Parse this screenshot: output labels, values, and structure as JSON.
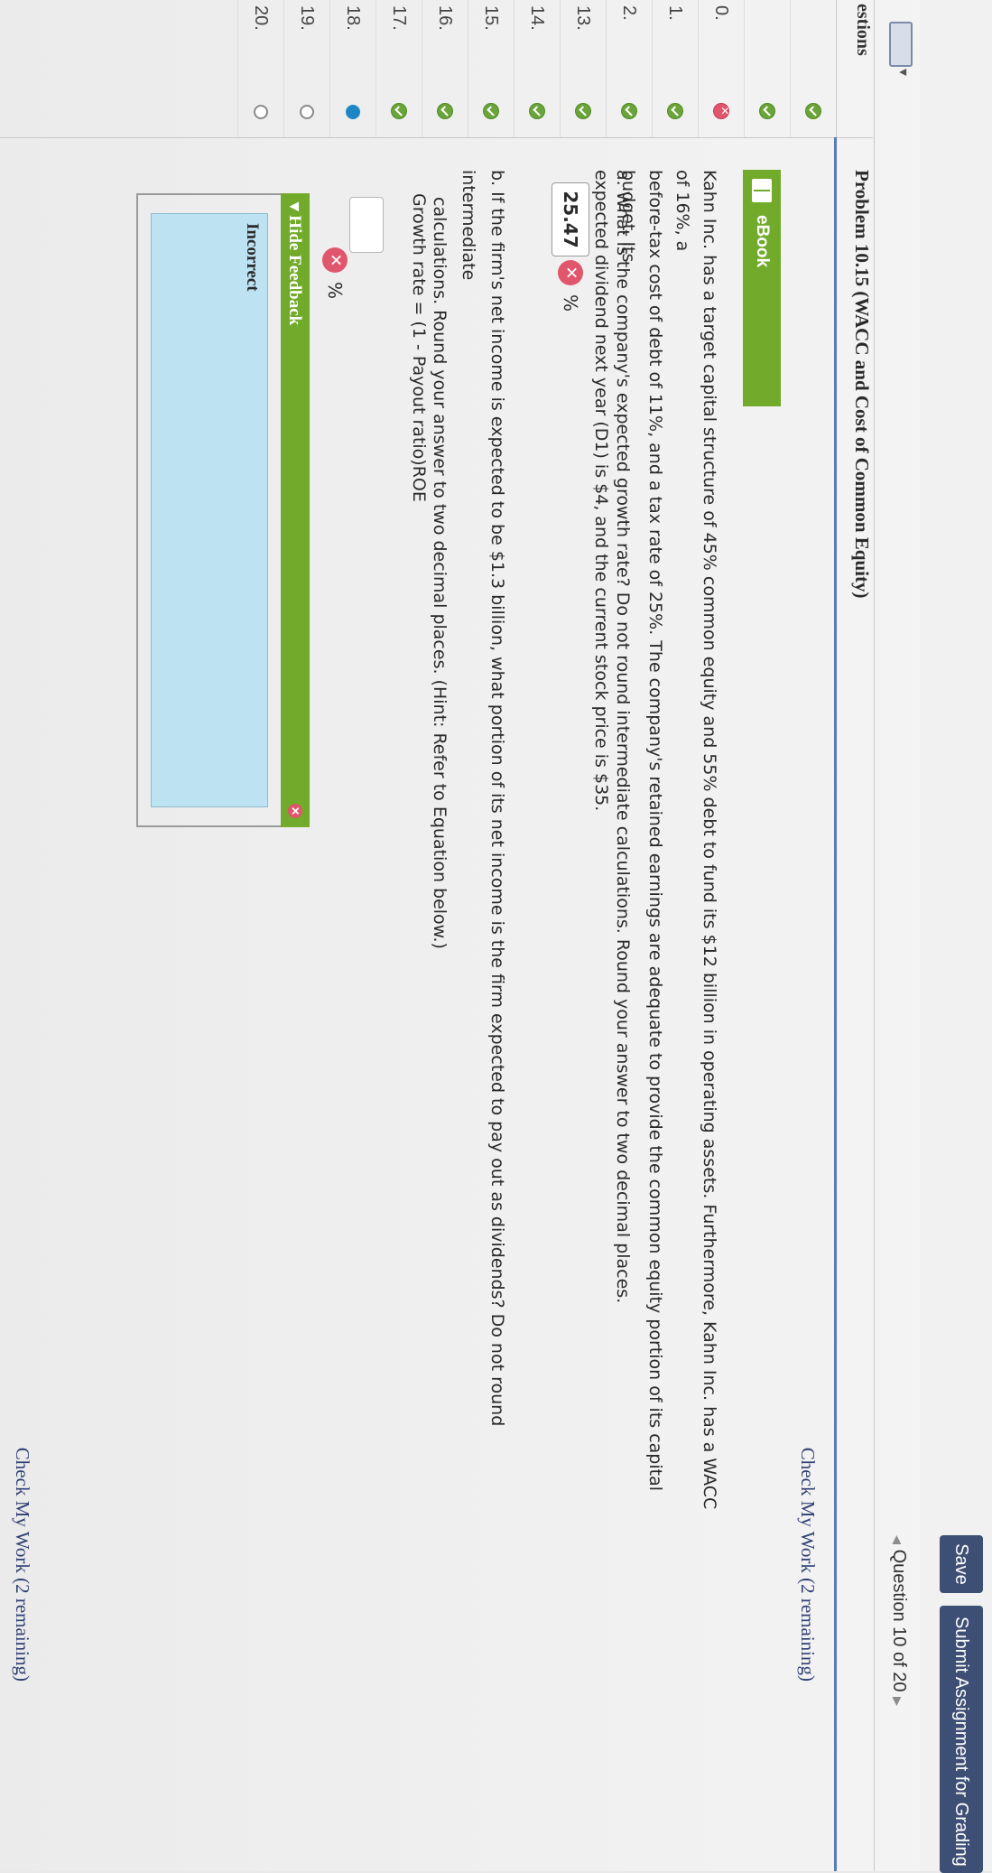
{
  "header": {
    "save_label": "Save",
    "submit_label": "Submit Assignment for Grading"
  },
  "nav": {
    "question_label": "Question 10 of 20"
  },
  "sidebar": {
    "heading": "estions",
    "items": [
      {
        "number": "",
        "status": "correct"
      },
      {
        "number": "",
        "status": "correct"
      },
      {
        "number": "0.",
        "status": "incorrect"
      },
      {
        "number": "1.",
        "status": "correct"
      },
      {
        "number": "2.",
        "status": "correct"
      },
      {
        "number": "13.",
        "status": "correct"
      },
      {
        "number": "14.",
        "status": "correct"
      },
      {
        "number": "15.",
        "status": "correct"
      },
      {
        "number": "16.",
        "status": "correct"
      },
      {
        "number": "17.",
        "status": "correct"
      },
      {
        "number": "18.",
        "status": "current"
      },
      {
        "number": "19.",
        "status": "unanswered"
      },
      {
        "number": "20.",
        "status": "unanswered"
      }
    ]
  },
  "problem": {
    "title": "Problem 10.15 (WACC and Cost of Common Equity)",
    "check_work_top": "Check My Work (2 remaining)",
    "check_work_bottom": "Check My Work (2 remaining)",
    "ebook_label": "eBook",
    "text_line1": "Kahn Inc. has a target capital structure of 45% common equity and 55% debt to fund its $12 billion in operating assets. Furthermore, Kahn Inc. has a WACC of 16%, a",
    "text_line2": "before-tax cost of debt of 11%, and a tax rate of 25%. The company's retained earnings are adequate to provide the common equity portion of its capital budget. Its",
    "text_line3": "expected dividend next year (D1) is $4, and the current stock price is $35.",
    "part_a": "a.  What is the company's expected growth rate? Do not round intermediate calculations. Round your answer to two decimal places.",
    "answer_a": "25.47",
    "percent": "%",
    "part_b_line1": "b.  If the firm's net income is expected to be $1.3 billion, what portion of its net income is the firm expected to pay out as dividends? Do not round intermediate",
    "part_b_line2": "calculations. Round your answer to two decimal places. (Hint: Refer to Equation below.)",
    "formula": "Growth rate = (1 - Payout ratio)ROE",
    "answer_b": "",
    "feedback_header": "Hide Feedback",
    "feedback_result": "Incorrect"
  },
  "colors": {
    "button_bg": "#3d4f74",
    "correct_green": "#6ba43a",
    "incorrect_red": "#e0566d",
    "current_blue": "#1f86c6",
    "ebook_green": "#72ab2b",
    "feedback_blue": "#bde3f2"
  }
}
